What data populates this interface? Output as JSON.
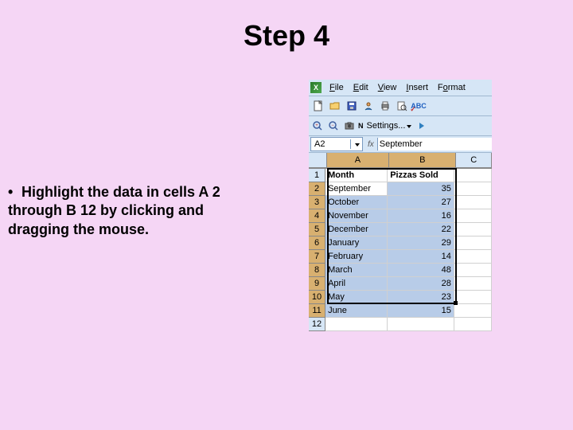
{
  "title": "Step 4",
  "instruction": "Highlight the data in cells A 2 through B 12 by clicking and dragging the mouse.",
  "menu": {
    "file": "File",
    "edit": "Edit",
    "view": "View",
    "insert": "Insert",
    "format": "Format"
  },
  "settings": {
    "label": "Settings..."
  },
  "namebox": {
    "value": "A2"
  },
  "formula": {
    "value": "September"
  },
  "columns": {
    "A": "A",
    "B": "B",
    "C": "C"
  },
  "headers": {
    "col_a": "Month",
    "col_b": "Pizzas Sold"
  },
  "rows": [
    {
      "n": "1"
    },
    {
      "n": "2",
      "a": "September",
      "b": "35"
    },
    {
      "n": "3",
      "a": "October",
      "b": "27"
    },
    {
      "n": "4",
      "a": "November",
      "b": "16"
    },
    {
      "n": "5",
      "a": "December",
      "b": "22"
    },
    {
      "n": "6",
      "a": "January",
      "b": "29"
    },
    {
      "n": "7",
      "a": "February",
      "b": "14"
    },
    {
      "n": "8",
      "a": "March",
      "b": "48"
    },
    {
      "n": "9",
      "a": "April",
      "b": "28"
    },
    {
      "n": "10",
      "a": "May",
      "b": "23"
    },
    {
      "n": "11",
      "a": "June",
      "b": "15"
    },
    {
      "n": "12"
    }
  ],
  "fx": "fx",
  "settings_n": "N"
}
